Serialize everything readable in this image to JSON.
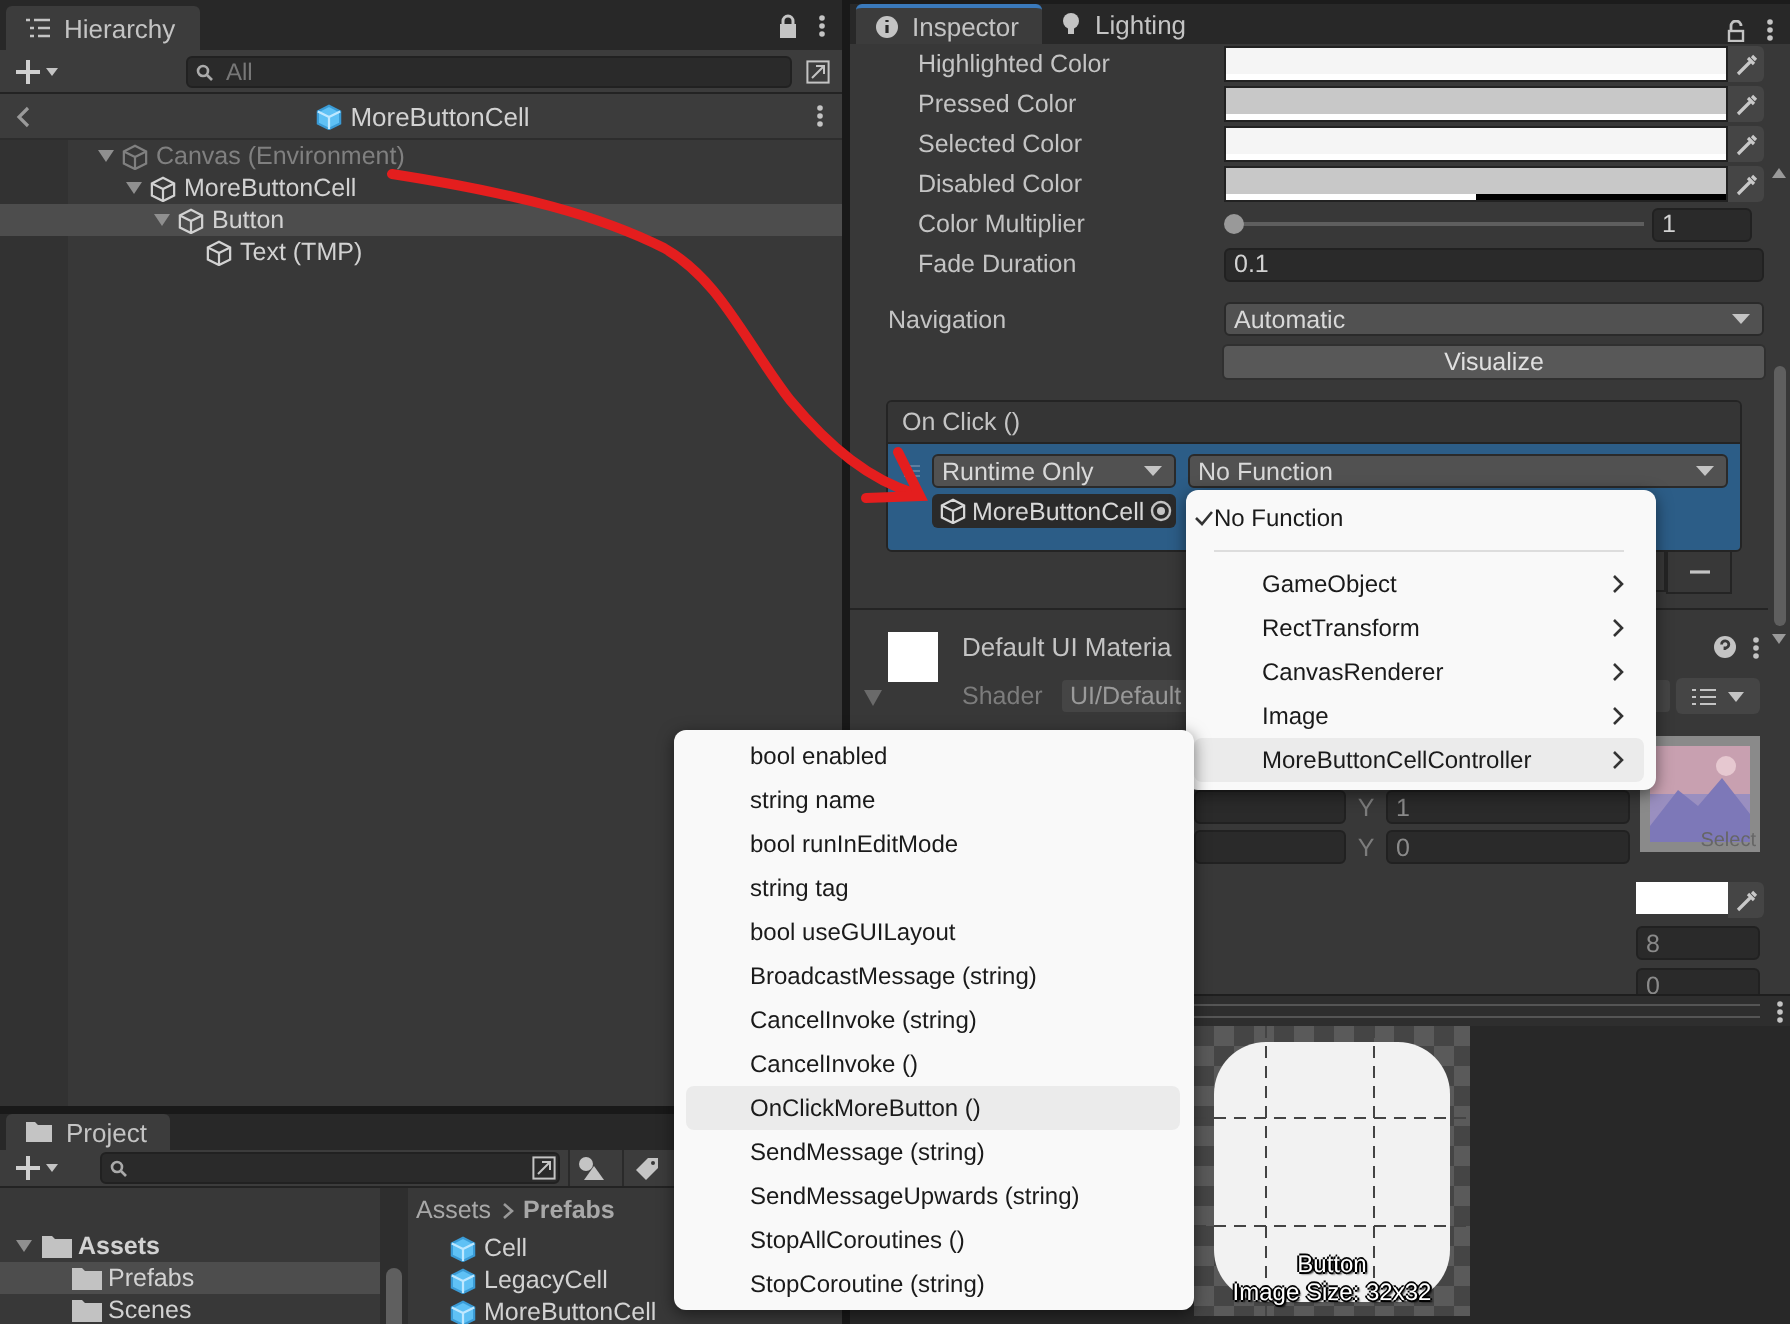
{
  "hierarchy": {
    "tab": "Hierarchy",
    "search_placeholder": "All",
    "prefab_title": "MoreButtonCell",
    "tree": [
      {
        "label": "Canvas (Environment)",
        "dimmed": true,
        "expanded": true,
        "selected": false,
        "children": [
          {
            "label": "MoreButtonCell",
            "dimmed": false,
            "expanded": true,
            "selected": false,
            "children": [
              {
                "label": "Button",
                "dimmed": false,
                "expanded": true,
                "selected": true,
                "children": [
                  {
                    "label": "Text (TMP)",
                    "dimmed": false,
                    "selected": false
                  }
                ]
              }
            ]
          }
        ]
      }
    ]
  },
  "project": {
    "tab": "Project",
    "folders": [
      {
        "label": "Assets",
        "expanded": true,
        "selected": false,
        "children": [
          {
            "label": "Prefabs",
            "selected": true
          },
          {
            "label": "Scenes",
            "selected": false
          }
        ]
      }
    ],
    "breadcrumb": [
      "Assets",
      "Prefabs"
    ],
    "items": [
      "Cell",
      "LegacyCell",
      "MoreButtonCell"
    ]
  },
  "inspector": {
    "tabs": [
      {
        "label": "Inspector",
        "selected": true
      },
      {
        "label": "Lighting",
        "selected": false
      }
    ],
    "color_rows": [
      {
        "label": "Highlighted Color",
        "color": "#f5f5f5",
        "level": 1
      },
      {
        "label": "Pressed Color",
        "color": "#c8c8c8",
        "level": 1
      },
      {
        "label": "Selected Color",
        "color": "#f5f5f5",
        "level": 1
      },
      {
        "label": "Disabled Color",
        "color": "#c8c8c8",
        "level": 0.5
      }
    ],
    "color_multiplier": {
      "label": "Color Multiplier",
      "level": 0,
      "value": "1"
    },
    "fade_duration": {
      "label": "Fade Duration",
      "value": "0.1"
    },
    "navigation": {
      "label": "Navigation",
      "value": "Automatic"
    },
    "visualize": "Visualize",
    "on_click": {
      "title": "On Click ()",
      "runtime": "Runtime Only",
      "function": "No Function",
      "target": "MoreButtonCell"
    },
    "material": {
      "name": "Default UI Materia",
      "shader_label": "Shader",
      "shader": "UI/Default"
    },
    "offset_rows": [
      {
        "axis": "Y",
        "value": "1"
      },
      {
        "axis": "Y",
        "value": "0"
      }
    ],
    "sprite_select": "Select",
    "numbers": [
      "8",
      "0"
    ],
    "preview": {
      "label": "Button",
      "size": "Image Size: 32x32"
    }
  },
  "component_menu": {
    "no_function": {
      "label": "No Function",
      "checked": true
    },
    "items": [
      {
        "label": "GameObject",
        "highlighted": false
      },
      {
        "label": "RectTransform",
        "highlighted": false
      },
      {
        "label": "CanvasRenderer",
        "highlighted": false
      },
      {
        "label": "Image",
        "highlighted": false
      },
      {
        "label": "MoreButtonCellController",
        "highlighted": true
      }
    ]
  },
  "method_menu": [
    {
      "label": "bool enabled",
      "highlighted": false
    },
    {
      "label": "string name",
      "highlighted": false
    },
    {
      "label": "bool runInEditMode",
      "highlighted": false
    },
    {
      "label": "string tag",
      "highlighted": false
    },
    {
      "label": "bool useGUILayout",
      "highlighted": false
    },
    {
      "label": "BroadcastMessage (string)",
      "highlighted": false
    },
    {
      "label": "CancelInvoke (string)",
      "highlighted": false
    },
    {
      "label": "CancelInvoke ()",
      "highlighted": false
    },
    {
      "label": "OnClickMoreButton ()",
      "highlighted": true
    },
    {
      "label": "SendMessage (string)",
      "highlighted": false
    },
    {
      "label": "SendMessageUpwards (string)",
      "highlighted": false
    },
    {
      "label": "StopAllCoroutines ()",
      "highlighted": false
    },
    {
      "label": "StopCoroutine (string)",
      "highlighted": false
    }
  ]
}
